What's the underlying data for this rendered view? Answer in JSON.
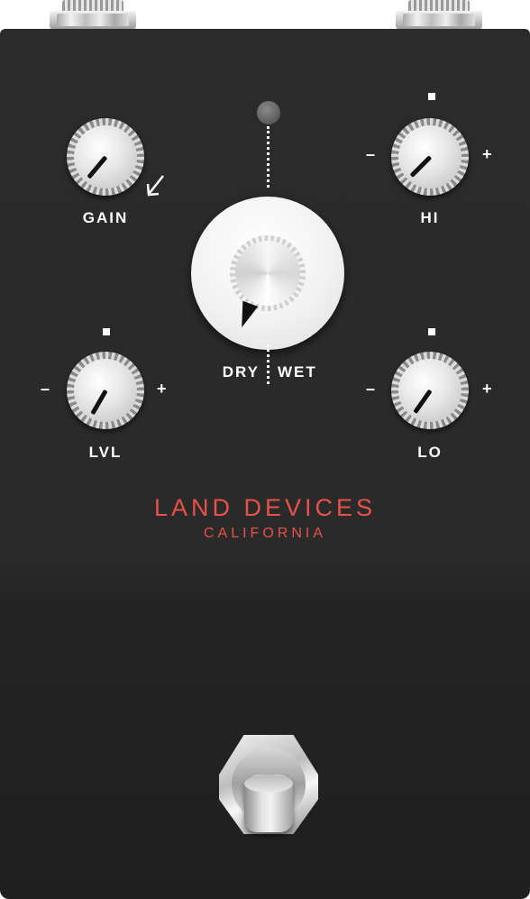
{
  "controls": {
    "gain": {
      "label": "GAIN",
      "setting_angle_deg": 220
    },
    "hi": {
      "label": "HI",
      "minus": "–",
      "plus": "+",
      "setting_angle_deg": 225
    },
    "lvl": {
      "label": "LVL",
      "minus": "–",
      "plus": "+",
      "setting_angle_deg": 210
    },
    "lo": {
      "label": "LO",
      "minus": "–",
      "plus": "+",
      "setting_angle_deg": 215
    },
    "mix": {
      "dry_label": "DRY",
      "wet_label": "WET"
    }
  },
  "brand": {
    "name": "LAND DEVICES",
    "location": "CALIFORNIA"
  },
  "colors": {
    "enclosure": "#2a2a2a",
    "brand_text": "#e8514a",
    "label_text": "#ffffff"
  }
}
